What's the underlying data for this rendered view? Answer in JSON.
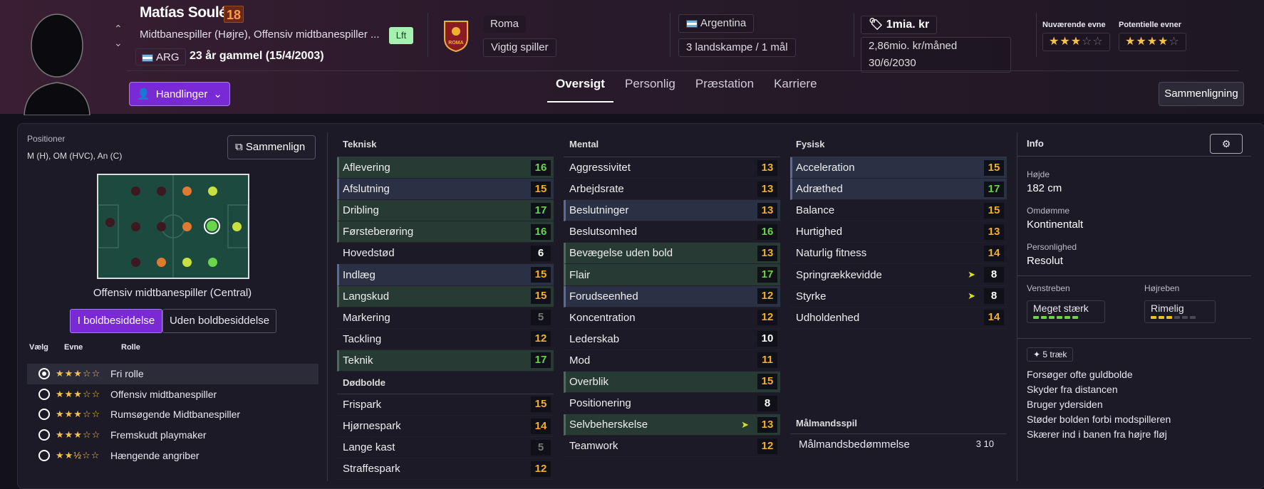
{
  "player": {
    "name": "Matías Soulé",
    "age_badge": "18",
    "positions_text": "Midtbanespiller (Højre), Offensiv midtbanespiller ...",
    "nationality": "ARG",
    "age_text": "23 år gammel (15/4/2003)",
    "lft": "Lft"
  },
  "club": {
    "name": "Roma",
    "status": "Vigtig spiller",
    "crest_text": "ROMA"
  },
  "nation": {
    "country": "Argentina",
    "caps": "3 landskampe / 1 mål"
  },
  "contract": {
    "value": "1mia. kr",
    "wage": "2,86mio. kr/måned",
    "expires": "30/6/2030"
  },
  "ability": {
    "current_label": "Nuværende evne",
    "potential_label": "Potentielle evner",
    "current_stars": 3,
    "potential_stars": 4
  },
  "tabs": [
    "Oversigt",
    "Personlig",
    "Præstation",
    "Karriere"
  ],
  "actions": {
    "handlinger": "Handlinger",
    "sammenligning": "Sammenligning"
  },
  "left": {
    "positions_label": "Positioner",
    "positions_value": "M (H), OM (HVC), An (C)",
    "compare_btn": "Sammenlign",
    "role_title": "Offensiv midtbanespiller (Central)",
    "toggle_on": "I boldbesiddelse",
    "toggle_off": "Uden boldbesiddelse",
    "col_select": "Vælg",
    "col_ability": "Evne",
    "col_role": "Rolle",
    "roles": [
      {
        "name": "Fri rolle",
        "stars": "★★★☆☆",
        "sel": true
      },
      {
        "name": "Offensiv midtbanespiller",
        "stars": "★★★☆☆",
        "sel": false
      },
      {
        "name": "Rumsøgende Midtbanespiller",
        "stars": "★★★☆☆",
        "sel": false
      },
      {
        "name": "Fremskudt playmaker",
        "stars": "★★★☆☆",
        "sel": false
      },
      {
        "name": "Hængende angriber",
        "stars": "★★½☆☆",
        "sel": false
      }
    ]
  },
  "attributes": {
    "teknisk": {
      "title": "Teknisk",
      "rows": [
        [
          "Aflevering",
          16,
          "g"
        ],
        [
          "Afslutning",
          15,
          "b"
        ],
        [
          "Dribling",
          17,
          "g"
        ],
        [
          "Førsteberøring",
          16,
          "g"
        ],
        [
          "Hovedstød",
          6,
          ""
        ],
        [
          "Indlæg",
          15,
          "b"
        ],
        [
          "Langskud",
          15,
          "g"
        ],
        [
          "Markering",
          5,
          ""
        ],
        [
          "Tackling",
          12,
          ""
        ],
        [
          "Teknik",
          17,
          "g"
        ]
      ]
    },
    "dodbolde": {
      "title": "Dødbolde",
      "rows": [
        [
          "Frispark",
          15,
          ""
        ],
        [
          "Hjørnespark",
          14,
          ""
        ],
        [
          "Lange kast",
          5,
          ""
        ],
        [
          "Straffespark",
          12,
          ""
        ]
      ]
    },
    "mental": {
      "title": "Mental",
      "rows": [
        [
          "Aggressivitet",
          13,
          ""
        ],
        [
          "Arbejdsrate",
          13,
          ""
        ],
        [
          "Beslutninger",
          13,
          "b"
        ],
        [
          "Beslutsomhed",
          16,
          ""
        ],
        [
          "Bevægelse uden bold",
          13,
          "g"
        ],
        [
          "Flair",
          17,
          "g"
        ],
        [
          "Forudseenhed",
          12,
          "b"
        ],
        [
          "Koncentration",
          12,
          ""
        ],
        [
          "Lederskab",
          10,
          ""
        ],
        [
          "Mod",
          11,
          ""
        ],
        [
          "Overblik",
          15,
          "g"
        ],
        [
          "Positionering",
          8,
          ""
        ],
        [
          "Selvbeherskelse",
          13,
          "g"
        ],
        [
          "Teamwork",
          12,
          ""
        ]
      ]
    },
    "fysisk": {
      "title": "Fysisk",
      "rows": [
        [
          "Acceleration",
          15,
          "b"
        ],
        [
          "Adræthed",
          17,
          "b"
        ],
        [
          "Balance",
          15,
          ""
        ],
        [
          "Hurtighed",
          13,
          ""
        ],
        [
          "Naturlig fitness",
          14,
          ""
        ],
        [
          "Springrækkevidde",
          8,
          ""
        ],
        [
          "Styrke",
          8,
          ""
        ],
        [
          "Udholdenhed",
          14,
          ""
        ]
      ]
    },
    "malmand": {
      "title": "Målmandsspil",
      "label": "Målmandsbedømmelse",
      "value": "3 10"
    }
  },
  "info": {
    "title": "Info",
    "height_label": "Højde",
    "height": "182 cm",
    "rep_label": "Omdømme",
    "rep": "Kontinentalt",
    "pers_label": "Personlighed",
    "pers": "Resolut",
    "left_foot_label": "Venstreben",
    "left_foot": "Meget stærk",
    "left_foot_level": 6,
    "right_foot_label": "Højreben",
    "right_foot": "Rimelig",
    "right_foot_level": 3,
    "traits_btn": "5 træk",
    "traits": [
      "Forsøger ofte guldbolde",
      "Skyder fra distancen",
      "Bruger ydersiden",
      "Støder bolden forbi modspilleren",
      "Skærer ind i banen fra højre fløj"
    ]
  },
  "colors": {
    "accent": "#7a2ad4",
    "green": "#6ad44a",
    "orange": "#f0b030"
  }
}
